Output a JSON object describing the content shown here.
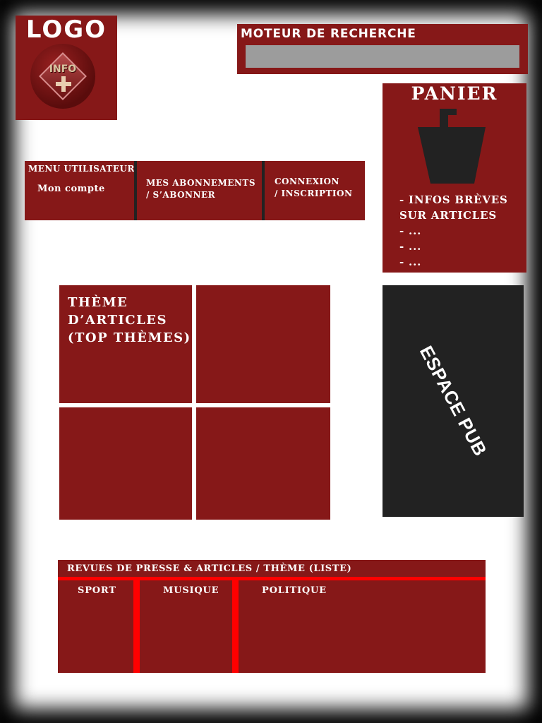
{
  "logo": {
    "title": "LOGO",
    "badge_text": "INFO"
  },
  "search": {
    "title": "MOTEUR DE RECHERCHE",
    "placeholder": ""
  },
  "cart": {
    "title": "PANIER",
    "icon": "cart-bag-icon",
    "items": [
      "- INFOS BRÈVES",
      "SUR ARTICLES",
      "- ...",
      "- ...",
      "- ..."
    ]
  },
  "user_menu": {
    "title": "MENU UTILISATEUR",
    "account": "Mon compte",
    "subscriptions_line1": "MES ABONNEMENTS",
    "subscriptions_line2": " / S’ABONNER",
    "login_line1": "CONNEXION",
    "login_line2": "/ INSCRIPTION"
  },
  "themes": {
    "tiles": [
      {
        "lines": [
          "THÈME",
          "D’ARTICLES",
          "(TOP THÈMES)"
        ]
      }
    ]
  },
  "ad": {
    "label": "ESPACE PUB"
  },
  "press": {
    "title": "REVUES DE PRESSE & ARTICLES / THÈME (LISTE)",
    "categories": [
      "SPORT",
      "MUSIQUE",
      "POLITIQUE"
    ]
  },
  "colors": {
    "primary_red": "#861818",
    "accent_red": "#ff0000",
    "dark": "#222222",
    "search_gray": "#9c9c9c"
  }
}
